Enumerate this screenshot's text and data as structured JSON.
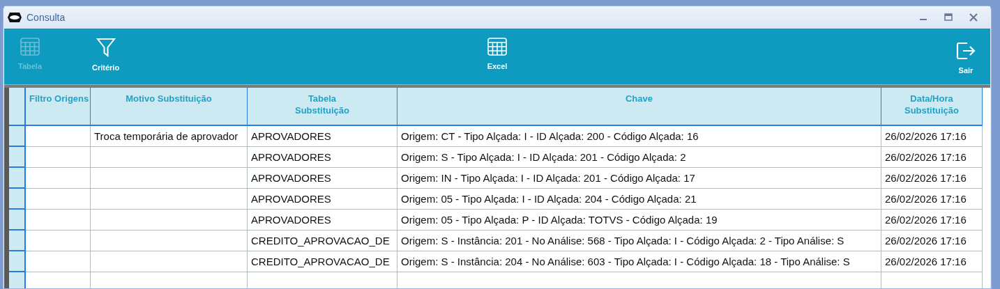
{
  "window": {
    "title": "Consulta"
  },
  "toolbar": {
    "left": [
      {
        "label": "Tabela",
        "kind": "table",
        "disabled": true
      },
      {
        "label": "Critério",
        "kind": "filter",
        "disabled": false
      }
    ],
    "center": [
      {
        "label": "Excel",
        "kind": "table",
        "disabled": false
      }
    ],
    "right": [
      {
        "label": "Sair",
        "kind": "exit",
        "disabled": false
      }
    ]
  },
  "table": {
    "columns": [
      {
        "label": "Filtro Origens"
      },
      {
        "label": "Motivo Substituição"
      },
      {
        "label": "Tabela\nSubstituição"
      },
      {
        "label": "Chave"
      },
      {
        "label": "Data/Hora\nSubstituição"
      }
    ],
    "rows": [
      {
        "cells": [
          "",
          "Troca temporária de aprovador",
          "APROVADORES",
          "Origem: CT - Tipo Alçada: I - ID Alçada: 200 - Código Alçada: 16",
          "26/02/2026 17:16"
        ]
      },
      {
        "cells": [
          "",
          "",
          "APROVADORES",
          "Origem: S - Tipo Alçada: I - ID Alçada: 201 - Código Alçada: 2",
          "26/02/2026 17:16"
        ]
      },
      {
        "cells": [
          "",
          "",
          "APROVADORES",
          "Origem: IN - Tipo Alçada: I - ID Alçada: 201 - Código Alçada: 17",
          "26/02/2026 17:16"
        ]
      },
      {
        "cells": [
          "",
          "",
          "APROVADORES",
          "Origem: 05 - Tipo Alçada: I - ID Alçada: 204 - Código Alçada: 21",
          "26/02/2026 17:16"
        ]
      },
      {
        "cells": [
          "",
          "",
          "APROVADORES",
          "Origem: 05 - Tipo Alçada: P - ID Alçada: TOTVS - Código Alçada: 19",
          "26/02/2026 17:16"
        ]
      },
      {
        "cells": [
          "",
          "",
          "CREDITO_APROVACAO_DE",
          "Origem: S - Instância: 201 - No Análise: 568 - Tipo Alçada: I - Código Alçada: 2 - Tipo Análise: S",
          "26/02/2026 17:16"
        ]
      },
      {
        "cells": [
          "",
          "",
          "CREDITO_APROVACAO_DE",
          "Origem: S - Instância: 204 - No Análise: 603 - Tipo Alçada: I - Código Alçada: 18 - Tipo Análise: S",
          "26/02/2026 17:16"
        ]
      }
    ]
  }
}
